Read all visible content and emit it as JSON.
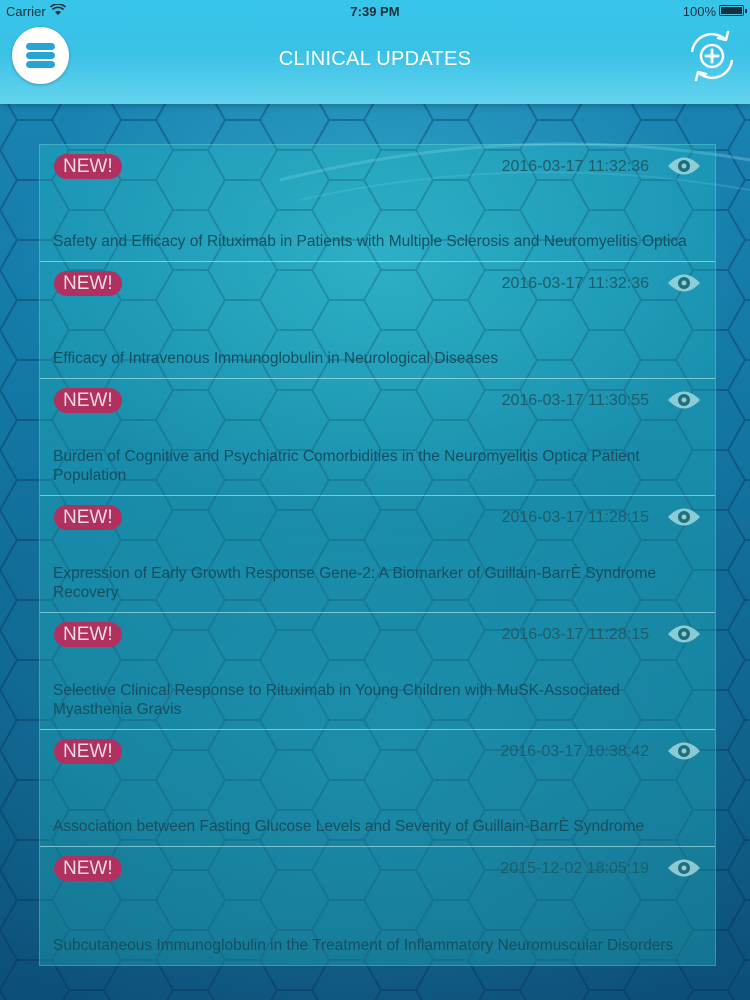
{
  "status_bar": {
    "carrier": "Carrier",
    "time": "7:39 PM",
    "battery": "100%"
  },
  "header": {
    "title": "CLINICAL UPDATES",
    "menu_icon": "hamburger-menu-icon",
    "sync_icon": "sync-refresh-icon"
  },
  "colors": {
    "header": "#3ac1e6",
    "badge": "#b0305f",
    "text": "#164f60"
  },
  "updates": [
    {
      "badge": "NEW!",
      "timestamp": "2016-03-17 11:32:36",
      "title": "Safety and Efficacy of Rituximab in Patients with Multiple Sclerosis and Neuromyelitis Optica"
    },
    {
      "badge": "NEW!",
      "timestamp": "2016-03-17 11:32:36",
      "title": "Efficacy of Intravenous Immunoglobulin in Neurological Diseases"
    },
    {
      "badge": "NEW!",
      "timestamp": "2016-03-17 11:30:55",
      "title": "Burden of Cognitive and Psychiatric Comorbidities in the Neuromyelitis Optica Patient Population"
    },
    {
      "badge": "NEW!",
      "timestamp": "2016-03-17 11:28:15",
      "title": "Expression of Early Growth Response Gene-2: A Biomarker of Guillain-BarrÈ Syndrome Recovery"
    },
    {
      "badge": "NEW!",
      "timestamp": "2016-03-17 11:28:15",
      "title": "Selective Clinical Response to Rituximab in Young Children with MuSK-Associated Myasthenia Gravis"
    },
    {
      "badge": "NEW!",
      "timestamp": "2016-03-17 10:38:42",
      "title": "Association between Fasting Glucose Levels and Severity of Guillain-BarrÈ Syndrome"
    },
    {
      "badge": "NEW!",
      "timestamp": "2015-12-02 18:05:19",
      "title": "Subcutaneous Immunoglobulin in the Treatment of Inflammatory Neuromuscular Disorders"
    }
  ]
}
